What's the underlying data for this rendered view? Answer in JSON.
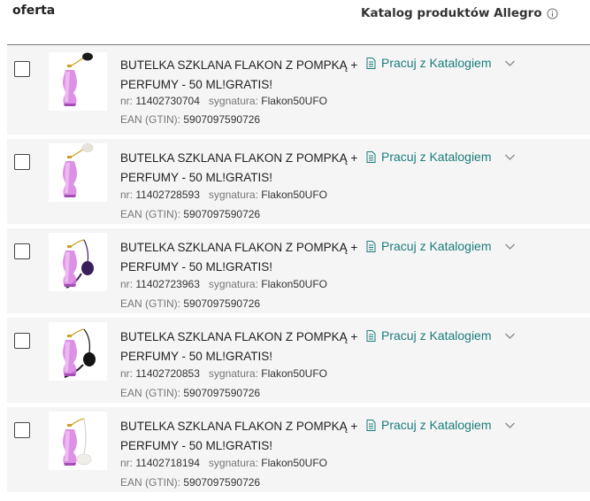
{
  "header": {
    "offer_label": "oferta",
    "catalog_label": "Katalog produktów Allegro",
    "info_icon": "info-icon"
  },
  "labels": {
    "nr": "nr:",
    "signature": "sygnatura:",
    "ean": "EAN (GTIN):"
  },
  "colors": {
    "accent": "#1a7d7a",
    "row_bg": "#f5f5f5"
  },
  "offers": [
    {
      "title": "BUTELKA SZKLANA FLAKON Z POMPKĄ + PERFUMY - 50 ML!GRATIS!",
      "nr": "11402730704",
      "signature": "Flakon50UFO",
      "ean": "5907097590726",
      "catalog_action": "Pracuj z Katalogiem",
      "pump_color": "#1a1a1a"
    },
    {
      "title": "BUTELKA SZKLANA FLAKON Z POMPKĄ + PERFUMY - 50 ML!GRATIS!",
      "nr": "11402728593",
      "signature": "Flakon50UFO",
      "ean": "5907097590726",
      "catalog_action": "Pracuj z Katalogiem",
      "pump_color": "#e6e2dc"
    },
    {
      "title": "BUTELKA SZKLANA FLAKON Z POMPKĄ + PERFUMY - 50 ML!GRATIS!",
      "nr": "11402723963",
      "signature": "Flakon50UFO",
      "ean": "5907097590726",
      "catalog_action": "Pracuj z Katalogiem",
      "pump_color": "#3a1f5c"
    },
    {
      "title": "BUTELKA SZKLANA FLAKON Z POMPKĄ + PERFUMY - 50 ML!GRATIS!",
      "nr": "11402720853",
      "signature": "Flakon50UFO",
      "ean": "5907097590726",
      "catalog_action": "Pracuj z Katalogiem",
      "pump_color": "#141414"
    },
    {
      "title": "BUTELKA SZKLANA FLAKON Z POMPKĄ + PERFUMY - 50 ML!GRATIS!",
      "nr": "11402718194",
      "signature": "Flakon50UFO",
      "ean": "5907097590726",
      "catalog_action": "Pracuj z Katalogiem",
      "pump_color": "#f0eeea"
    }
  ]
}
